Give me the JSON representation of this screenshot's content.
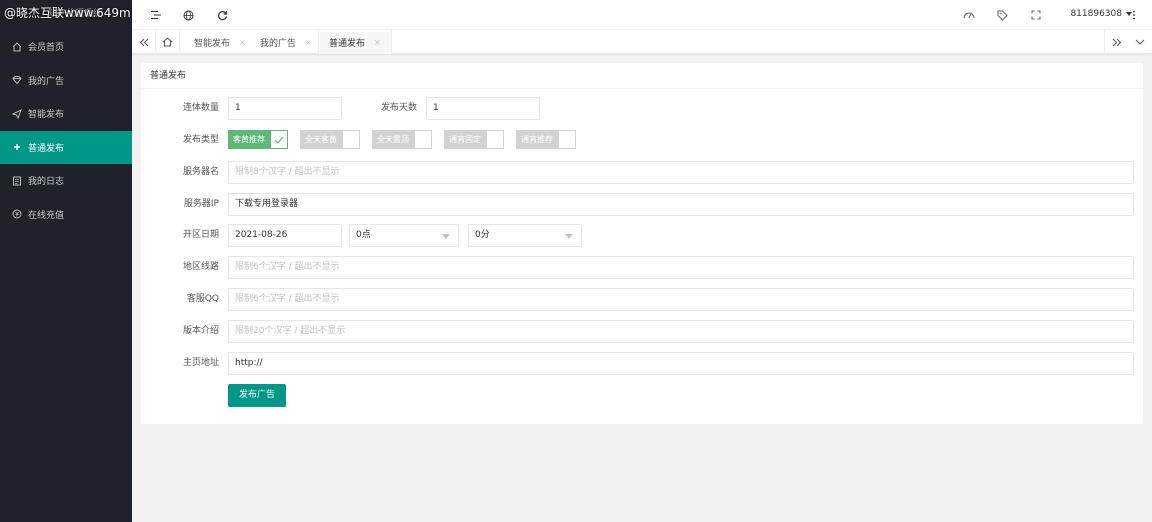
{
  "watermark": "@晓杰互联www.649m",
  "app_title": "知产代理系统",
  "sidebar": {
    "items": [
      {
        "label": "会员首页",
        "icon": "home-icon"
      },
      {
        "label": "我的广告",
        "icon": "diamond-icon"
      },
      {
        "label": "智能发布",
        "icon": "send-icon"
      },
      {
        "label": "普通发布",
        "icon": "plus-icon",
        "active": true
      },
      {
        "label": "我的日志",
        "icon": "log-icon"
      },
      {
        "label": "在线充值",
        "icon": "recharge-icon"
      }
    ]
  },
  "header": {
    "icons": [
      "menu-toggle-icon",
      "globe-icon",
      "refresh-icon",
      "theme-icon",
      "tag-icon",
      "fullscreen-icon",
      "more-vertical-icon"
    ],
    "username": "811896308"
  },
  "tabs": {
    "items": [
      {
        "label": "智能发布",
        "close": "×"
      },
      {
        "label": "我的广告",
        "close": "×"
      },
      {
        "label": "普通发布",
        "close": "×",
        "active": true
      }
    ]
  },
  "form": {
    "title": "普通发布",
    "count_label": "连体数量",
    "count_value": "1",
    "days_label": "发布天数",
    "days_value": "1",
    "type_label": "发布类型",
    "types": [
      {
        "label": "客黄推荐",
        "checked": true
      },
      {
        "label": "全天客黄",
        "checked": false
      },
      {
        "label": "全天置顶",
        "checked": false
      },
      {
        "label": "通宵固定",
        "checked": false
      },
      {
        "label": "通宵推荐",
        "checked": false
      }
    ],
    "server_name_label": "服务器名",
    "server_name_placeholder": "限制8个汉字 / 超出不显示",
    "server_ip_label": "服务器IP",
    "server_ip_value": "下载专用登录器",
    "open_date_label": "开区日期",
    "open_date_value": "2021-08-26",
    "hour_value": "0点",
    "minute_value": "0分",
    "region_label": "地区线路",
    "region_placeholder": "限制6个汉字 / 超出不显示",
    "qq_label": "客服QQ",
    "qq_placeholder": "限制6个汉字 / 超出不显示",
    "version_label": "版本介绍",
    "version_placeholder": "限制20个汉字 / 超出不显示",
    "homepage_label": "主页地址",
    "homepage_value": "http://",
    "submit_label": "发布广告"
  },
  "colors": {
    "sidebar_bg": "#20222a",
    "accent": "#009688",
    "checkbox_on": "#5fb878"
  }
}
